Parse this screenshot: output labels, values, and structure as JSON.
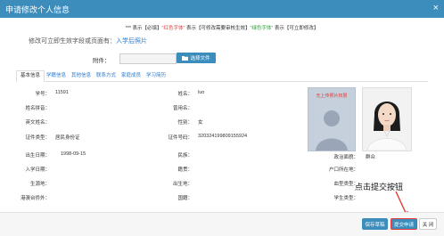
{
  "dialog": {
    "title": "申请修改个人信息",
    "close_glyph": "×"
  },
  "legend": {
    "p1": "*** 表示【必填】",
    "p2": "\"红色字体\"",
    "p3": " 表示【可修改需要审核生效】",
    "p4": "\"绿色字体\"",
    "p5": " 表示【可立即修改】"
  },
  "hint": {
    "prefix": "修改可立即生效字段或页面有：",
    "link": "入学后照片"
  },
  "attachment": {
    "label": "附件：",
    "value": "",
    "button_label": "选择文件",
    "button_icon": "folder-icon"
  },
  "tabs": [
    {
      "label": "基本信息"
    },
    {
      "label": "学籍信息"
    },
    {
      "label": "其他信息"
    },
    {
      "label": "联系方式"
    },
    {
      "label": "家庭成员"
    },
    {
      "label": "学习简历"
    }
  ],
  "fields": {
    "student_id": {
      "label": "学号：",
      "value": "11591"
    },
    "name": {
      "label": "姓名：",
      "value": "luo"
    },
    "name_pinyin": {
      "label": "姓名拼音：",
      "value": ""
    },
    "former_name": {
      "label": "曾用名：",
      "value": ""
    },
    "english_name": {
      "label": "英文姓名：",
      "value": ""
    },
    "gender": {
      "label": "性别：",
      "value": "女"
    },
    "id_type": {
      "label": "证件类型：",
      "value": "居民身份证"
    },
    "id_number": {
      "label": "证件号码：",
      "value": "320324199809155924"
    },
    "birth_date": {
      "label": "出生日期：",
      "value": "1998-09-15"
    },
    "ethnicity": {
      "label": "民族：",
      "value": ""
    },
    "political_status": {
      "label": "政治面貌：",
      "value": "群众"
    },
    "enroll_date": {
      "label": "入学日期：",
      "value": ""
    },
    "native_place": {
      "label": "籍贯：",
      "value": ""
    },
    "hukou": {
      "label": "户口所在地：",
      "value": ""
    },
    "source_place": {
      "label": "生源地：",
      "value": ""
    },
    "birthplace": {
      "label": "出生地：",
      "value": ""
    },
    "blood_type": {
      "label": "血型类型：",
      "value": ""
    },
    "hk_macau_taiwan": {
      "label": "港澳台侨外：",
      "value": ""
    },
    "nationality": {
      "label": "国籍：",
      "value": ""
    },
    "student_category": {
      "label": "学生类型：",
      "value": ""
    }
  },
  "photos": {
    "upload_caption": "无上传照片权限"
  },
  "annotation": "点击提交按钮",
  "footer": {
    "save": "保存草稿",
    "submit": "提交申请",
    "close": "关 闭"
  }
}
